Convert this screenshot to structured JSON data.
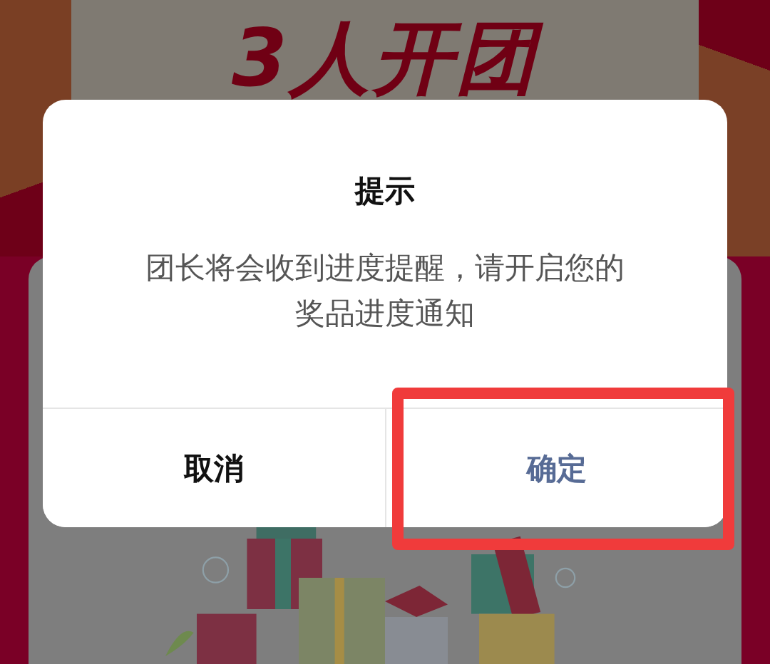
{
  "banner": {
    "title": "3人开团"
  },
  "dialog": {
    "title": "提示",
    "message": "团长将会收到进度提醒，请开启您的奖品进度通知",
    "buttons": [
      {
        "label": "取消",
        "kind": "cancel"
      },
      {
        "label": "确定",
        "kind": "confirm",
        "highlighted": true
      }
    ]
  }
}
